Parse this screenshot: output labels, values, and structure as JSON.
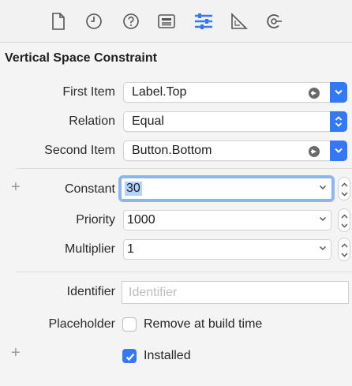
{
  "toolbar": {
    "icons": [
      {
        "name": "file-inspector-icon"
      },
      {
        "name": "history-inspector-icon"
      },
      {
        "name": "quick-help-icon"
      },
      {
        "name": "identity-inspector-icon"
      },
      {
        "name": "attributes-inspector-icon",
        "selected": true
      },
      {
        "name": "size-inspector-icon"
      },
      {
        "name": "connections-inspector-icon"
      }
    ],
    "selected_color": "#3478f6"
  },
  "section": {
    "title": "Vertical Space Constraint"
  },
  "fields": {
    "first_item": {
      "label": "First Item",
      "value": "Label.Top"
    },
    "relation": {
      "label": "Relation",
      "value": "Equal"
    },
    "second_item": {
      "label": "Second Item",
      "value": "Button.Bottom"
    },
    "constant": {
      "label": "Constant",
      "value": "30"
    },
    "priority": {
      "label": "Priority",
      "value": "1000"
    },
    "multiplier": {
      "label": "Multiplier",
      "value": "1"
    },
    "identifier": {
      "label": "Identifier",
      "value": "",
      "placeholder": "Identifier"
    },
    "placeholder": {
      "label": "Placeholder",
      "checkbox_label": "Remove at build time",
      "checked": false
    },
    "installed": {
      "checkbox_label": "Installed",
      "checked": true
    }
  },
  "plus_symbol": "+"
}
